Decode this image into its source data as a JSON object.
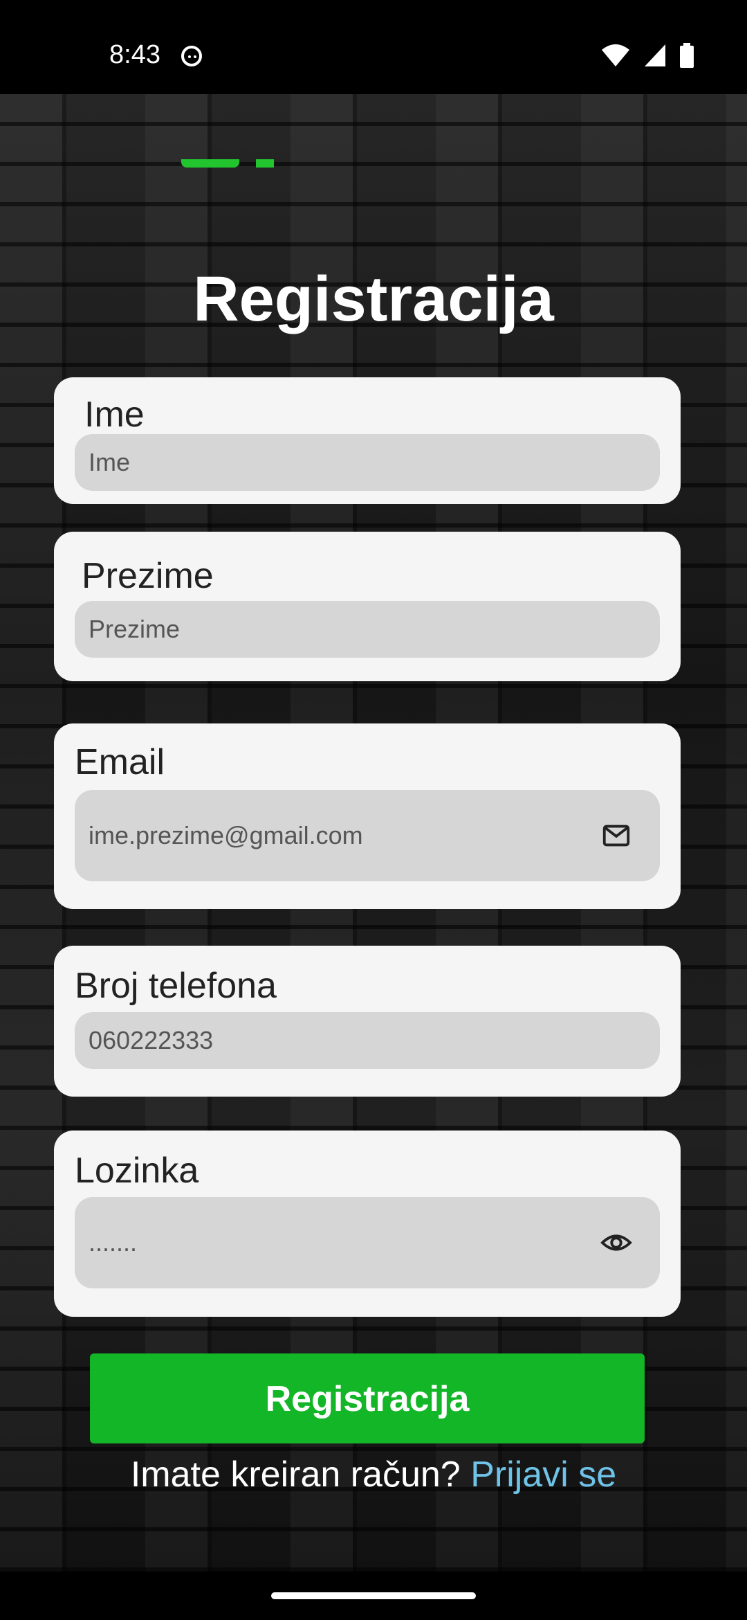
{
  "status_bar": {
    "time": "8:43"
  },
  "title": "Registracija",
  "form": {
    "first_name": {
      "label": "Ime",
      "placeholder": "Ime"
    },
    "last_name": {
      "label": "Prezime",
      "placeholder": "Prezime"
    },
    "email": {
      "label": "Email",
      "placeholder": "ime.prezime@gmail.com",
      "icon": "mail-icon"
    },
    "phone": {
      "label": "Broj telefona",
      "placeholder": "060222333"
    },
    "password": {
      "label": "Lozinka",
      "placeholder": ".......",
      "icon": "eye-icon"
    }
  },
  "actions": {
    "register_label": "Registracija",
    "have_account_text": "Imate kreiran račun?",
    "login_link": "Prijavi se"
  },
  "colors": {
    "accent_green": "#12b627",
    "link_blue": "#6fc3e8",
    "card_bg": "#f5f5f5",
    "field_bg": "#d6d6d6"
  }
}
